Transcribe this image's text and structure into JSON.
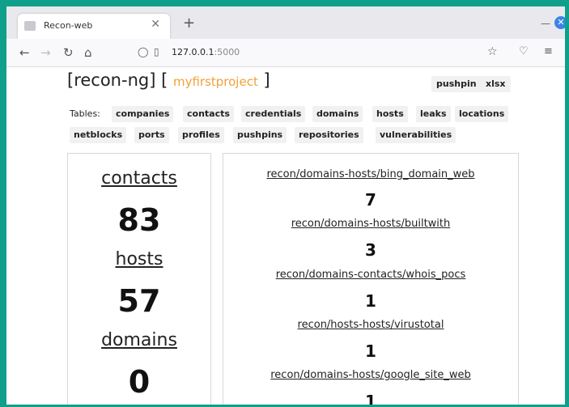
{
  "browser": {
    "tab_title": "Recon-web",
    "url_host": "127.0.0.1",
    "url_port": ":5000"
  },
  "header": {
    "brand": "[recon-ng] [",
    "project": "myfirstproject",
    "brand_close": "]",
    "buttons": [
      "pushpin",
      "xlsx"
    ]
  },
  "tables": {
    "label": "Tables:",
    "items": [
      "companies",
      "contacts",
      "credentials",
      "domains",
      "hosts",
      "leaks",
      "locations",
      "netblocks",
      "ports",
      "profiles",
      "pushpins",
      "repositories",
      "vulnerabilities"
    ]
  },
  "stats": [
    {
      "label": "contacts",
      "value": "83"
    },
    {
      "label": "hosts",
      "value": "57"
    },
    {
      "label": "domains",
      "value": "0"
    }
  ],
  "modules": [
    {
      "name": "recon/domains-hosts/bing_domain_web",
      "count": "7"
    },
    {
      "name": "recon/domains-hosts/builtwith",
      "count": "3"
    },
    {
      "name": "recon/domains-contacts/whois_pocs",
      "count": "1"
    },
    {
      "name": "recon/hosts-hosts/virustotal",
      "count": "1"
    },
    {
      "name": "recon/domains-hosts/google_site_web",
      "count": "1"
    }
  ]
}
